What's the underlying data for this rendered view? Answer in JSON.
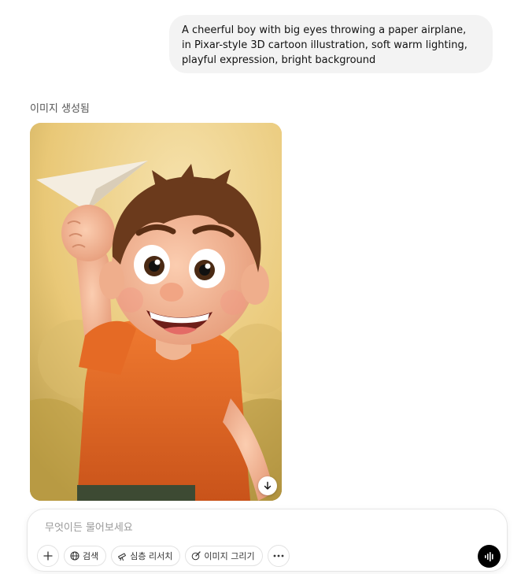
{
  "conversation": {
    "user_message": "A cheerful boy with big eyes throwing a paper airplane, in Pixar-style 3D cartoon illustration, soft warm lighting, playful expression, bright background",
    "assistant": {
      "status_label": "이미지 생성됨"
    }
  },
  "composer": {
    "placeholder": "무엇이든 물어보세요",
    "value": "",
    "tools": {
      "search_label": "검색",
      "deep_research_label": "심층 리서치",
      "create_image_label": "이미지 그리기"
    }
  },
  "icons": {
    "plus": "plus-icon",
    "globe": "globe-icon",
    "telescope": "telescope-icon",
    "paint": "paint-icon",
    "more": "more-icon",
    "download": "download-icon",
    "voice": "voice-icon"
  },
  "colors": {
    "user_bubble_bg": "#f3f3f3",
    "voice_button_bg": "#000000",
    "boy_shirt": "#e86a24"
  }
}
